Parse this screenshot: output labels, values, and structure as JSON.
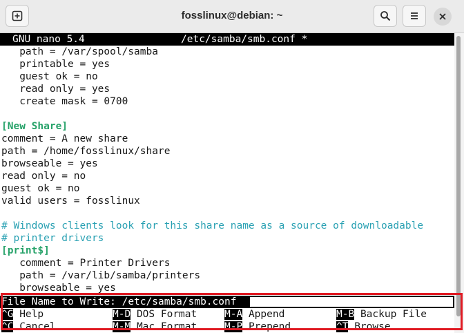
{
  "window": {
    "title": "fosslinux@debian: ~"
  },
  "nano": {
    "version_label": "GNU nano 5.4",
    "filename": "/etc/samba/smb.conf *"
  },
  "lines": [
    "   path = /var/spool/samba",
    "   printable = yes",
    "   guest ok = no",
    "   read only = yes",
    "   create mask = 0700",
    "",
    "[New Share]",
    "comment = A new share",
    "path = /home/fosslinux/share",
    "browseable = yes",
    "read only = no",
    "guest ok = no",
    "valid users = fosslinux",
    "",
    "# Windows clients look for this share name as a source of downloadable",
    "# printer drivers",
    "[print$]",
    "   comment = Printer Drivers",
    "   path = /var/lib/samba/printers",
    "   browseable = yes"
  ],
  "prompt": {
    "text": "File Name to Write: /etc/samba/smb.conf"
  },
  "shortcuts": [
    {
      "key": "^G",
      "label": "Help"
    },
    {
      "key": "M-D",
      "label": "DOS Format"
    },
    {
      "key": "M-A",
      "label": "Append"
    },
    {
      "key": "M-B",
      "label": "Backup File"
    },
    {
      "key": "^C",
      "label": "Cancel"
    },
    {
      "key": "M-M",
      "label": "Mac Format"
    },
    {
      "key": "M-P",
      "label": "Prepend"
    },
    {
      "key": "^T",
      "label": "Browse"
    }
  ],
  "icons": {
    "new_tab": "new-tab-icon",
    "search": "search-icon",
    "menu": "hamburger-menu-icon",
    "close": "close-icon"
  }
}
